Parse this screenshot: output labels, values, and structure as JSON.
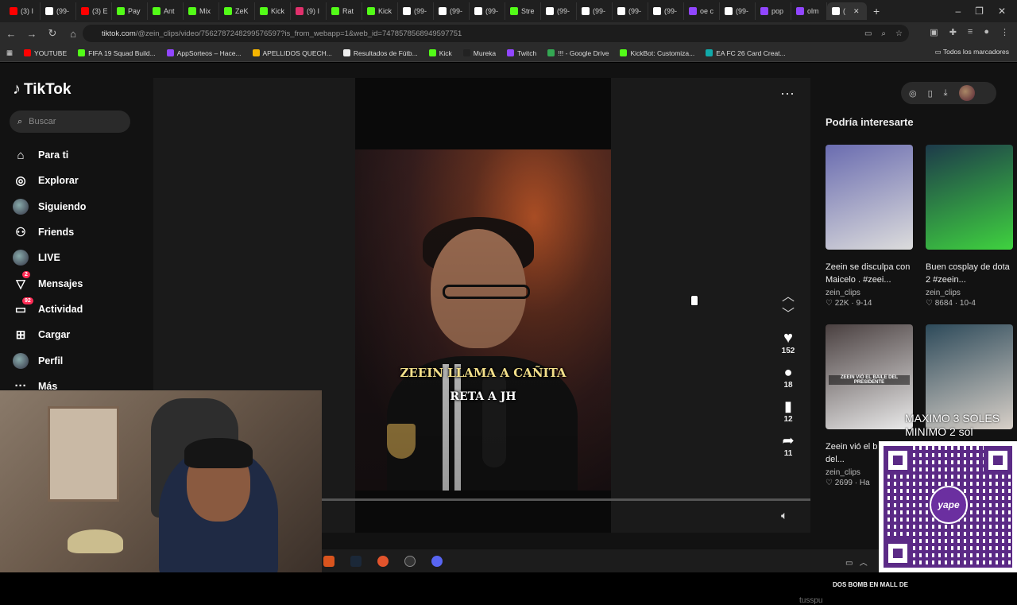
{
  "browser": {
    "tabs": [
      {
        "label": "(3) I",
        "color": "#ff0000"
      },
      {
        "label": "(99-",
        "color": "#ffffff"
      },
      {
        "label": "(3) E",
        "color": "#ff0000"
      },
      {
        "label": "Pay",
        "color": "#53fc18"
      },
      {
        "label": "Ant",
        "color": "#53fc18"
      },
      {
        "label": "Mix",
        "color": "#53fc18"
      },
      {
        "label": "ZeK",
        "color": "#53fc18"
      },
      {
        "label": "Kick",
        "color": "#53fc18"
      },
      {
        "label": "(9) I",
        "color": "#e1306c"
      },
      {
        "label": "Rat",
        "color": "#53fc18"
      },
      {
        "label": "Kick",
        "color": "#53fc18"
      },
      {
        "label": "(99-",
        "color": "#ffffff"
      },
      {
        "label": "(99-",
        "color": "#ffffff"
      },
      {
        "label": "(99-",
        "color": "#ffffff"
      },
      {
        "label": "Stre",
        "color": "#53fc18"
      },
      {
        "label": "(99-",
        "color": "#ffffff"
      },
      {
        "label": "(99-",
        "color": "#ffffff"
      },
      {
        "label": "(99-",
        "color": "#ffffff"
      },
      {
        "label": "(99-",
        "color": "#ffffff"
      },
      {
        "label": "oe c",
        "color": "#9146ff"
      },
      {
        "label": "(99-",
        "color": "#ffffff"
      },
      {
        "label": "pop",
        "color": "#9146ff"
      },
      {
        "label": "olm",
        "color": "#9146ff"
      },
      {
        "label": "(",
        "color": "#ffffff",
        "active": true
      }
    ],
    "new_tab": "+",
    "window_controls": [
      "–",
      "❐",
      "✕"
    ],
    "url_host": "tiktok.com",
    "url_path": "/@zein_clips/video/7562787248299576597?is_from_webapp=1&web_id=7478578568949597751",
    "bookmarks": [
      {
        "label": "YOUTUBE",
        "color": "#ff0000"
      },
      {
        "label": "FIFA 19 Squad Build...",
        "color": "#53fc18"
      },
      {
        "label": "AppSorteos – Hace...",
        "color": "#9146ff"
      },
      {
        "label": "APELLIDOS QUECH...",
        "color": "#f4b400"
      },
      {
        "label": "Resultados de Fútb...",
        "color": "#eeeeee"
      },
      {
        "label": "Kick",
        "color": "#53fc18"
      },
      {
        "label": "Mureka",
        "color": "#222222"
      },
      {
        "label": "Twitch",
        "color": "#9146ff"
      },
      {
        "label": "!!! - Google Drive",
        "color": "#34a853"
      },
      {
        "label": "KickBot: Customiza...",
        "color": "#53fc18"
      },
      {
        "label": "EA FC 26 Card Creat...",
        "color": "#1aa"
      }
    ],
    "bookmarks_all": "Todos los marcadores"
  },
  "tiktok": {
    "logo": "TikTok",
    "search_placeholder": "Buscar",
    "nav": [
      {
        "label": "Para ti",
        "icon": "home-icon",
        "glyph": "⌂"
      },
      {
        "label": "Explorar",
        "icon": "compass-icon",
        "glyph": "◎"
      },
      {
        "label": "Siguiendo",
        "icon": "following-avatar-icon",
        "glyph": ""
      },
      {
        "label": "Friends",
        "icon": "friends-icon",
        "glyph": "⚇"
      },
      {
        "label": "LIVE",
        "icon": "live-avatar-icon",
        "glyph": ""
      },
      {
        "label": "Mensajes",
        "icon": "messages-icon",
        "glyph": "▽",
        "badge": "2"
      },
      {
        "label": "Actividad",
        "icon": "activity-icon",
        "glyph": "▭",
        "badge": "92"
      },
      {
        "label": "Cargar",
        "icon": "upload-icon",
        "glyph": "⊞"
      },
      {
        "label": "Perfil",
        "icon": "profile-avatar-icon",
        "glyph": ""
      },
      {
        "label": "Más",
        "icon": "more-icon",
        "glyph": "···"
      }
    ],
    "video": {
      "caption_line1": "ZEEIN LLAMA A CAÑITA",
      "caption_line2": "RETA A JH",
      "likes": "152",
      "comments": "18",
      "saves": "12",
      "shares": "11"
    },
    "recommendations_title": "Podría interesarte",
    "recommendations": [
      {
        "title": "Zeein se disculpa con Maicelo . #zeei...",
        "user": "zein_clips",
        "likes": "22K",
        "date": "9-14",
        "colors": [
          "#6a6cb0",
          "#dcdcdc"
        ]
      },
      {
        "title": "Buen cosplay de dota 2 #zeein...",
        "user": "zein_clips",
        "likes": "8684",
        "date": "10-4",
        "colors": [
          "#1d3a4a",
          "#3fd23f"
        ]
      },
      {
        "title": "Zeein vió el b imitador del...",
        "user": "zein_clips",
        "likes": "2699",
        "date": "Ha",
        "colors": [
          "#4a4040",
          "#eaeaea"
        ],
        "overlay": "ZEEIN VIÓ EL BAILE DEL PRESIDENTE"
      },
      {
        "title": "",
        "user": "",
        "likes": "",
        "date": "",
        "colors": [
          "#2d4a5a",
          "#d8d0c8"
        ]
      }
    ],
    "bottom_label": "DOS BOMB EN MALL DE",
    "ghost_user": "tusspu"
  },
  "overlay": {
    "donation_line1": "MAXIMO 3 SOLES",
    "donation_line2": "MINIMO 2 sol",
    "yape_label": "yape"
  }
}
